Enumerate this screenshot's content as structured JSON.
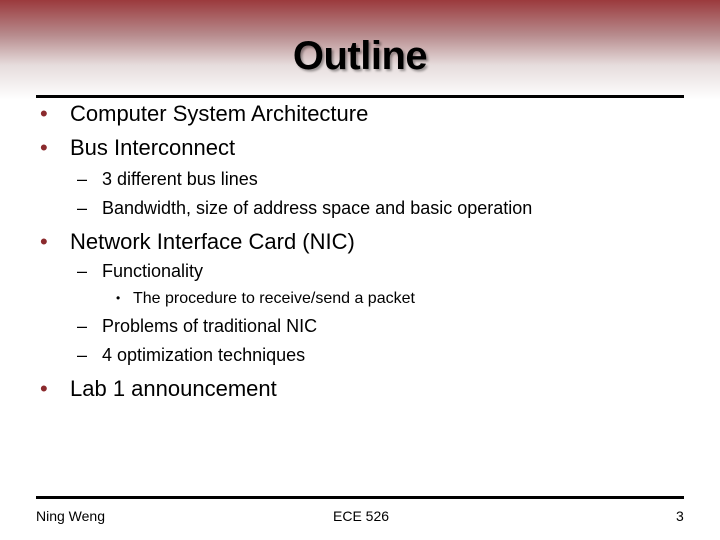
{
  "slide": {
    "title": "Outline",
    "bullets": [
      {
        "marker": "•",
        "text": "Computer System Architecture"
      },
      {
        "marker": "•",
        "text": "Bus Interconnect",
        "children": [
          {
            "marker": "–",
            "text": "3 different bus lines"
          },
          {
            "marker": "–",
            "text": "Bandwidth, size of address space and basic operation"
          }
        ]
      },
      {
        "marker": "•",
        "text": "Network Interface Card (NIC)",
        "children": [
          {
            "marker": "–",
            "text": "Functionality",
            "children": [
              {
                "marker": "•",
                "text": "The procedure to receive/send a packet"
              }
            ]
          },
          {
            "marker": "–",
            "text": "Problems of traditional NIC"
          },
          {
            "marker": "–",
            "text": "4 optimization techniques"
          }
        ]
      },
      {
        "marker": "•",
        "text": "Lab 1 announcement"
      }
    ]
  },
  "footer": {
    "author": "Ning Weng",
    "course": "ECE 526",
    "page_number": "3"
  },
  "colors": {
    "header_top": "#9b3a3d",
    "bullet": "#8b2a2d"
  }
}
